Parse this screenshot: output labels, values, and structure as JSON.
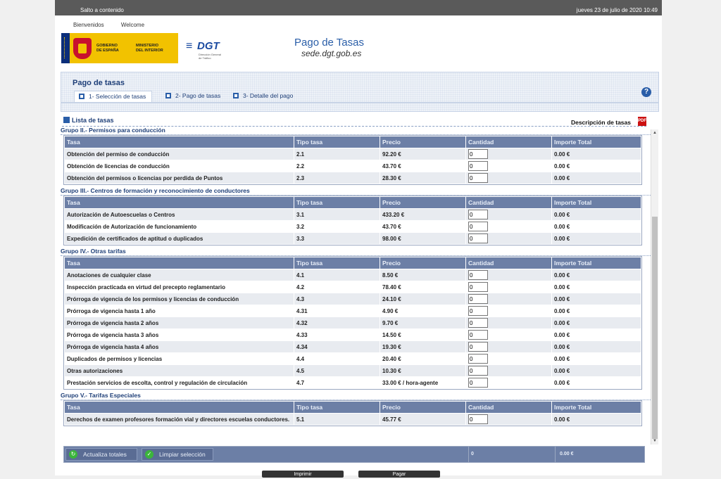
{
  "topbar": {
    "skip": "Salto a contenido",
    "date": "jueves 23 de julio de 2020 10:49"
  },
  "nav": {
    "welcome_es": "Bienvenidos",
    "welcome_en": "Welcome"
  },
  "logos": {
    "gov_line1": "GOBIERNO",
    "gov_line2": "DE ESPAÑA",
    "min_line1": "MINISTERIO",
    "min_line2": "DEL INTERIOR",
    "dgt": "DGT",
    "dgt_sub1": "Dirección General",
    "dgt_sub2": "de Tráfico"
  },
  "header": {
    "title": "Pago de Tasas",
    "subtitle": "sede.dgt.gob.es"
  },
  "section": {
    "title": "Pago de tasas",
    "tabs": [
      {
        "label": "1- Selección de tasas"
      },
      {
        "label": "2- Pago de tasas"
      },
      {
        "label": "3- Detalle del pago"
      }
    ],
    "help": "?"
  },
  "list": {
    "title": "Lista de tasas",
    "desc_link": "Descripción de tasas",
    "pdf": "PDF"
  },
  "columns": {
    "tasa": "Tasa",
    "tipo": "Tipo tasa",
    "precio": "Precio",
    "cantidad": "Cantidad",
    "importe": "Importe Total"
  },
  "groups": [
    {
      "title": "Grupo II.- Permisos para conducción",
      "rows": [
        {
          "name": "Obtención del permiso de conducción",
          "tipo": "2.1",
          "precio": "92.20 €",
          "qty": "0",
          "importe": "0.00 €"
        },
        {
          "name": "Obtención de licencias de conducción",
          "tipo": "2.2",
          "precio": "43.70 €",
          "qty": "0",
          "importe": "0.00 €"
        },
        {
          "name": "Obtención del permisos o licencias por perdida de Puntos",
          "tipo": "2.3",
          "precio": "28.30 €",
          "qty": "0",
          "importe": "0.00 €"
        }
      ]
    },
    {
      "title": "Grupo III.- Centros de formación y reconocimiento de conductores",
      "rows": [
        {
          "name": "Autorización de Autoescuelas o Centros",
          "tipo": "3.1",
          "precio": "433.20 €",
          "qty": "0",
          "importe": "0.00 €"
        },
        {
          "name": "Modificación de Autorización de funcionamiento",
          "tipo": "3.2",
          "precio": "43.70 €",
          "qty": "0",
          "importe": "0.00 €"
        },
        {
          "name": "Expedición de certificados de aptitud o duplicados",
          "tipo": "3.3",
          "precio": "98.00 €",
          "qty": "0",
          "importe": "0.00 €"
        }
      ]
    },
    {
      "title": "Grupo IV.- Otras tarifas",
      "rows": [
        {
          "name": "Anotaciones de cualquier clase",
          "tipo": "4.1",
          "precio": "8.50 €",
          "qty": "0",
          "importe": "0.00 €"
        },
        {
          "name": "Inspección practicada en virtud del precepto reglamentario",
          "tipo": "4.2",
          "precio": "78.40 €",
          "qty": "0",
          "importe": "0.00 €"
        },
        {
          "name": "Prórroga de vigencia de los permisos y licencias de conducción",
          "tipo": "4.3",
          "precio": "24.10 €",
          "qty": "0",
          "importe": "0.00 €"
        },
        {
          "name": "Prórroga de vigencia hasta 1 año",
          "tipo": "4.31",
          "precio": "4.90 €",
          "qty": "0",
          "importe": "0.00 €"
        },
        {
          "name": "Prórroga de vigencia hasta 2 años",
          "tipo": "4.32",
          "precio": "9.70 €",
          "qty": "0",
          "importe": "0.00 €"
        },
        {
          "name": "Prórroga de vigencia hasta 3 años",
          "tipo": "4.33",
          "precio": "14.50 €",
          "qty": "0",
          "importe": "0.00 €"
        },
        {
          "name": "Prórroga de vigencia hasta 4 años",
          "tipo": "4.34",
          "precio": "19.30 €",
          "qty": "0",
          "importe": "0.00 €"
        },
        {
          "name": "Duplicados de permisos y licencias",
          "tipo": "4.4",
          "precio": "20.40 €",
          "qty": "0",
          "importe": "0.00 €"
        },
        {
          "name": "Otras autorizaciones",
          "tipo": "4.5",
          "precio": "10.30 €",
          "qty": "0",
          "importe": "0.00 €"
        },
        {
          "name": "Prestación servicios de escolta, control y regulación de circulación",
          "tipo": "4.7",
          "precio": "33.00 € / hora-agente",
          "qty": "0",
          "importe": "0.00 €"
        }
      ]
    },
    {
      "title": "Grupo V.- Tarifas Especiales",
      "rows": [
        {
          "name": "Derechos de examen profesores formación vial y directores escuelas conductores.",
          "tipo": "5.1",
          "precio": "45.77 €",
          "qty": "0",
          "importe": "0.00 €"
        }
      ]
    }
  ],
  "totals": {
    "update_btn": "Actualiza totales",
    "clear_btn": "Limpiar selección",
    "qty_total": "0",
    "importe_total": "0.00 €"
  },
  "bottom": {
    "btn1": "Imprimir",
    "btn2": "Pagar"
  }
}
